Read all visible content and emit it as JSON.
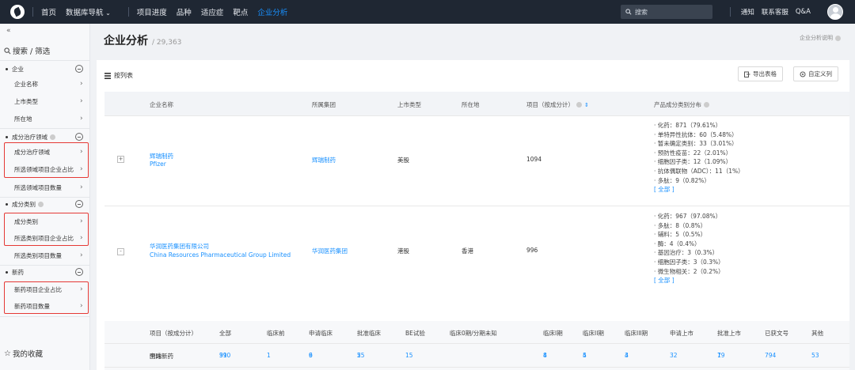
{
  "nav": {
    "items": [
      "首页",
      "数据库导航",
      "项目进度",
      "品种",
      "适应症",
      "靶点",
      "企业分析"
    ],
    "search_placeholder": "搜索",
    "right_links": [
      "通知",
      "联系客服",
      "Q&A"
    ]
  },
  "sidebar": {
    "collapse": "«",
    "search_label": "搜索 / 筛选",
    "groups": [
      {
        "label": "企业",
        "items": [
          "企业名称",
          "上市类型",
          "所在地"
        ]
      },
      {
        "label": "成分治疗领域",
        "items": [
          "成分治疗领域",
          "所选领域项目企业占比",
          "所选领域项目数量"
        ]
      },
      {
        "label": "成分类别",
        "items": [
          "成分类别",
          "所选类别项目企业占比",
          "所选类别项目数量"
        ]
      },
      {
        "label": "新药",
        "items": [
          "新药项目企业占比",
          "新药项目数量"
        ]
      }
    ],
    "favorites": "我的收藏"
  },
  "page": {
    "title": "企业分析",
    "count": "29,363",
    "note": "企业分析说明"
  },
  "table": {
    "list_label": "按列表",
    "export_label": "导出表格",
    "customize_label": "自定义列",
    "headers": [
      "企业名称",
      "所属集团",
      "上市类型",
      "所在地",
      "项目（按成分计）",
      "产品成分类别分布"
    ],
    "rows": [
      {
        "expander": "+",
        "name_cn": "辉瑞制药",
        "name_en": "Pfizer",
        "group": "辉瑞制药",
        "listing": "美股",
        "location": "",
        "projects": "1094",
        "dist": [
          "· 化药：871（79.61%）",
          "· 单特异性抗体：60（5.48%）",
          "· 暂未确定类别：33（3.01%）",
          "· 预防性疫苗：22（2.01%）",
          "· 细胞因子类：12（1.09%）",
          "· 抗体偶联物（ADC）：11（1%）",
          "· 多肽：9（0.82%）"
        ],
        "all": "[ 全部 ]"
      },
      {
        "expander": "-",
        "name_cn": "华润医药集团有限公司",
        "name_en": "China Resources Pharmaceutical Group Limited",
        "group": "华润医药集团",
        "listing": "港股",
        "location": "香港",
        "projects": "996",
        "dist": [
          "· 化药：967（97.08%）",
          "· 多肽：8（0.8%）",
          "· 辅料：5（0.5%）",
          "· 酶：4（0.4%）",
          "· 基因治疗：3（0.3%）",
          "· 细胞因子类：3（0.3%）",
          "· 微生物相关：2（0.2%）"
        ],
        "all": "[ 全部 ]"
      }
    ],
    "sub": {
      "headers": [
        "项目（按成分计）",
        "全部",
        "临床前",
        "申请临床",
        "批准临床",
        "BE试验",
        "临床0期/分期未知",
        "临床I期",
        "临床II期",
        "临床III期",
        "申请上市",
        "批准上市",
        "已获文号",
        "其他"
      ],
      "rows": [
        {
          "label": "国内",
          "values": [
            "990",
            "",
            "6",
            "55",
            "15",
            "",
            "8",
            "4",
            "4",
            "32",
            "19",
            "794",
            "53"
          ]
        },
        {
          "label": "全球新药",
          "values": [
            "31",
            "1",
            "9",
            "2",
            "",
            "",
            "4",
            "5",
            "3",
            "",
            "7",
            "",
            ""
          ]
        }
      ]
    }
  },
  "colors": {
    "nav_bg": "#1f2733",
    "accent": "#1890ff",
    "highlight": "#e53935"
  }
}
